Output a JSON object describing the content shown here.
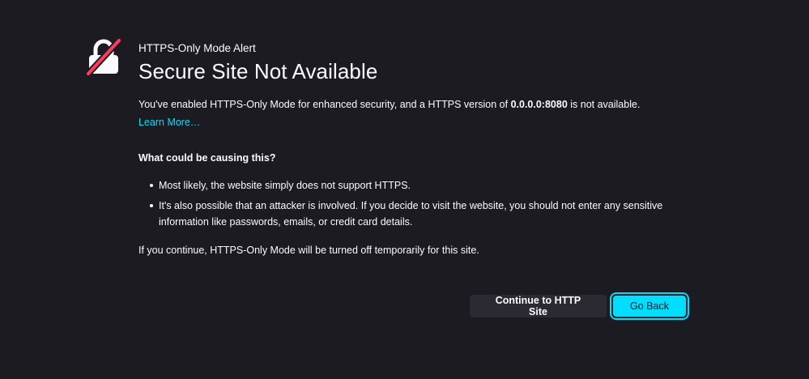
{
  "alert": {
    "subtitle": "HTTPS-Only Mode Alert",
    "title": "Secure Site Not Available",
    "description_before": "You've enabled HTTPS-Only Mode for enhanced security, and a HTTPS version of ",
    "description_host": "0.0.0.0:8080",
    "description_after": " is not available.",
    "learn_more": "Learn More…",
    "causes_heading": "What could be causing this?",
    "causes": [
      "Most likely, the website simply does not support HTTPS.",
      "It's also possible that an attacker is involved. If you decide to visit the website, you should not enter any sensitive information like passwords, emails, or credit card details."
    ],
    "footer_note": "If you continue, HTTPS-Only Mode will be turned off temporarily for this site."
  },
  "buttons": {
    "continue_label": "Continue to HTTP Site",
    "go_back_label": "Go Back"
  },
  "icons": {
    "alert_icon": "broken-lock-icon"
  },
  "colors": {
    "background": "#1c1b22",
    "accent": "#00ddff",
    "lock_strike": "#ff3b5b"
  }
}
